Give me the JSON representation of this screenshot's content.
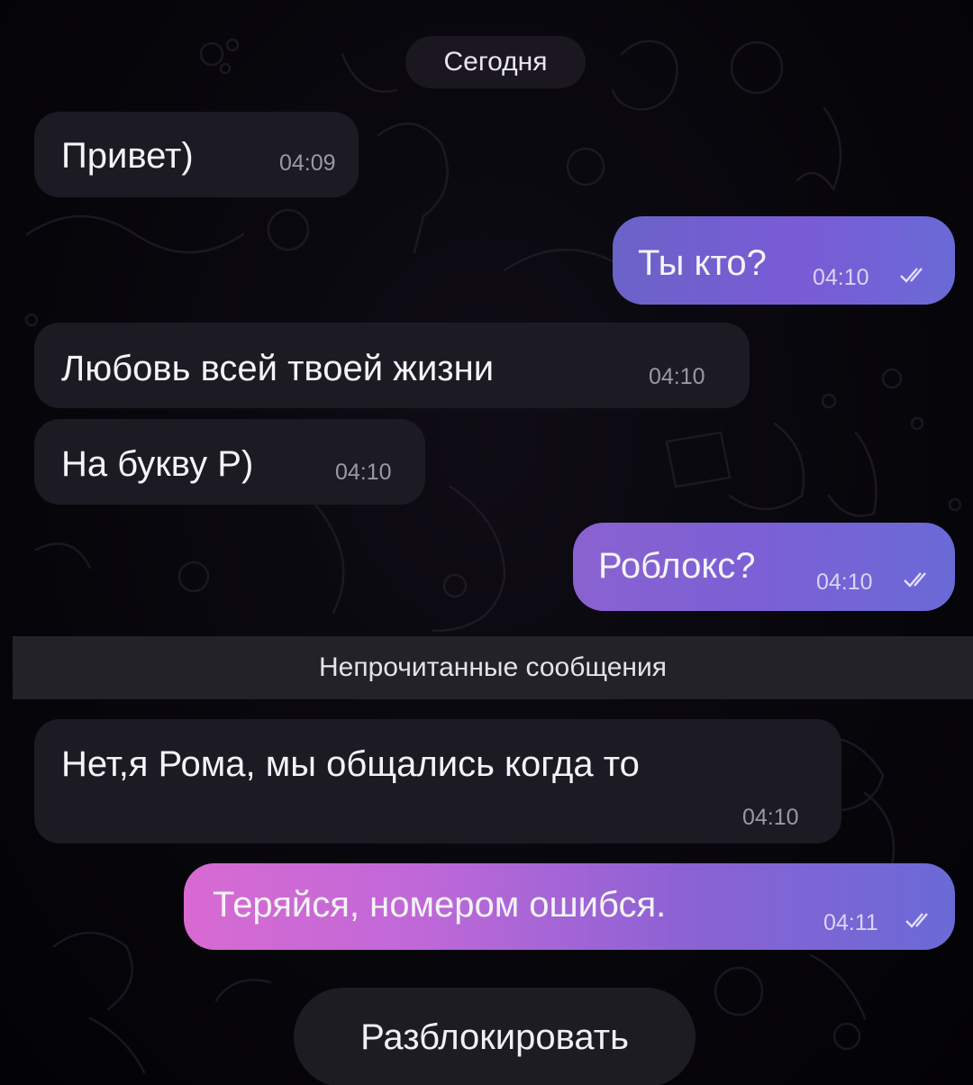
{
  "chat": {
    "date_label": "Сегодня",
    "unread_separator": "Непрочитанные сообщения",
    "unblock_label": "Разблокировать",
    "messages": [
      {
        "direction": "incoming",
        "text": "Привет)",
        "time": "04:09"
      },
      {
        "direction": "outgoing",
        "text": "Ты кто?",
        "time": "04:10",
        "status": "read"
      },
      {
        "direction": "incoming",
        "text": "Любовь всей твоей жизни",
        "time": "04:10"
      },
      {
        "direction": "incoming",
        "text": "На букву Р)",
        "time": "04:10"
      },
      {
        "direction": "outgoing",
        "text": "Роблокс?",
        "time": "04:10",
        "status": "read"
      },
      {
        "direction": "incoming",
        "text": "Нет,я Рома, мы общались когда то",
        "time": "04:10"
      },
      {
        "direction": "outgoing",
        "text": "Теряйся, номером ошибся.",
        "time": "04:11",
        "status": "read"
      }
    ]
  },
  "icons": {
    "read_status": "double-check-icon",
    "background": "doodle-pattern"
  },
  "colors": {
    "background": "#050409",
    "incoming_bubble": "#1c1a22",
    "outgoing_gradient_start": "#6a63c8",
    "outgoing_gradient_pink": "#d36ad2",
    "outgoing_gradient_end": "#6a6ad6",
    "unread_bar": "#232229"
  }
}
